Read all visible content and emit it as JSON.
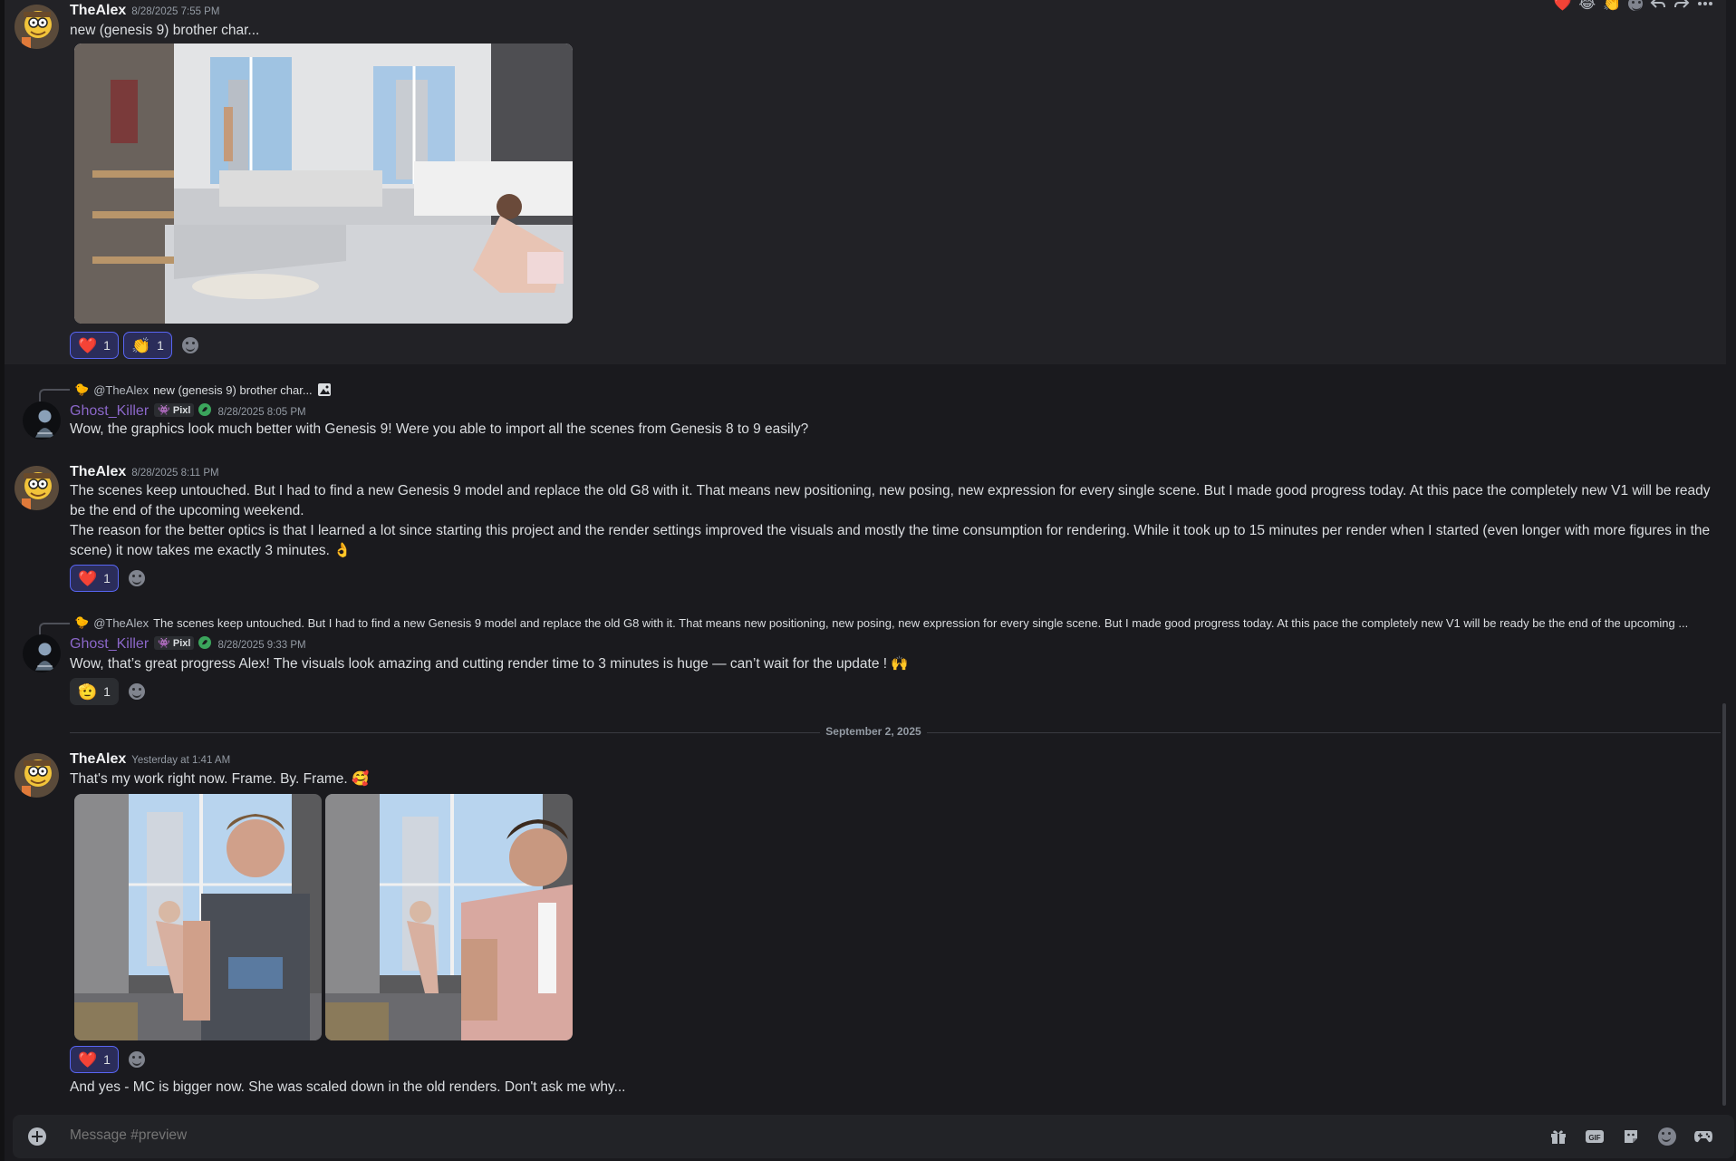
{
  "channel": {
    "composer_placeholder": "Message #preview"
  },
  "hover_toolbar": {
    "reactions": [
      "❤️",
      "😂",
      "👏"
    ],
    "icons": [
      "add-reaction-icon",
      "reply-icon",
      "forward-icon",
      "more-icon"
    ]
  },
  "messages": [
    {
      "author": "TheAlex",
      "timestamp": "8/28/2025 7:55 PM",
      "text": "new (genesis 9) brother char...",
      "reactions": [
        {
          "emoji": "❤️",
          "count": "1"
        },
        {
          "emoji": "👏",
          "count": "1"
        }
      ]
    },
    {
      "reply_to": {
        "mention": "@TheAlex",
        "preview": "new (genesis 9) brother char..."
      },
      "author": "Ghost_Killer",
      "badge": "Pixl",
      "timestamp": "8/28/2025 8:05 PM",
      "text": "Wow, the graphics look much better with Genesis 9!  Were you able to import all the scenes from Genesis 8 to 9 easily?"
    },
    {
      "author": "TheAlex",
      "timestamp": "8/28/2025 8:11 PM",
      "text_1": "The scenes keep untouched. But I had to find a new Genesis 9 model and replace the old G8 with it. That means new positioning, new posing, new expression for every single scene. But I made good progress today. At this pace the completely new V1 will be ready be the end of the upcoming weekend.",
      "text_2": "The reason for the better optics is that I learned a lot since starting this project and the render settings improved the visuals and mostly the time consumption for rendering. While it took up to 15 minutes per render when I started (even longer with more figures in the scene) it now takes me exactly 3 minutes. 👌",
      "reactions": [
        {
          "emoji": "❤️",
          "count": "1"
        }
      ]
    },
    {
      "reply_to": {
        "mention": "@TheAlex",
        "preview": "The scenes keep untouched. But I had to find a new Genesis 9 model and replace the old G8 with it. That means new positioning, new posing, new expression for every single scene. But I made good progress today. At this pace the completely new V1 will be ready be the end of the upcoming ..."
      },
      "author": "Ghost_Killer",
      "badge": "Pixl",
      "timestamp": "8/28/2025 9:33 PM",
      "text": "Wow, that’s great progress Alex! The visuals look amazing and cutting render time to 3 minutes is huge — can’t wait for the update  ! 🙌",
      "reactions": [
        {
          "emoji": "🫡",
          "count": "1"
        }
      ]
    },
    {
      "author": "TheAlex",
      "timestamp": "Yesterday at 1:41 AM",
      "text": "That's my work right now. Frame. By. Frame. 🥰",
      "reactions": [
        {
          "emoji": "❤️",
          "count": "1"
        }
      ],
      "followup": "And yes - MC is bigger now. She was scaled down in the old renders. Don't ask me why..."
    }
  ],
  "date_divider": "September 2, 2025"
}
